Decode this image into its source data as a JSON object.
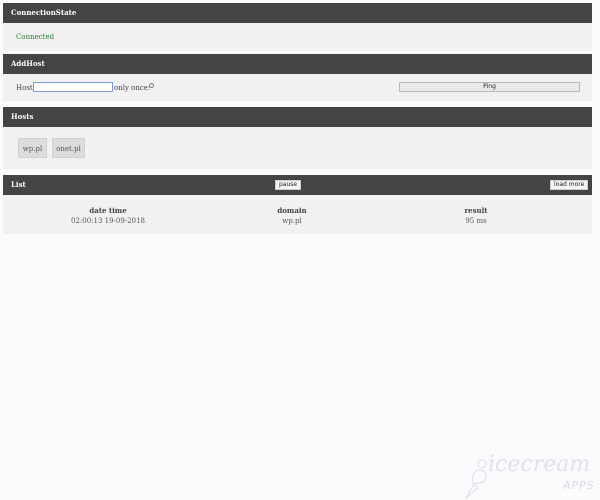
{
  "connection_state": {
    "title": "ConnectionState",
    "status": "Connected"
  },
  "add_host": {
    "title": "AddHost",
    "host_label": "Host:",
    "host_value": "",
    "only_once_label": "only once:",
    "only_once_checked": false,
    "ping_label": "Ping"
  },
  "hosts": {
    "title": "Hosts",
    "items": [
      "wp.pl",
      "onet.pl"
    ]
  },
  "list": {
    "title": "List",
    "pause_label": "pause",
    "load_more_label": "load more",
    "columns": [
      "date time",
      "domain",
      "result"
    ],
    "rows": [
      [
        "02:00:13 19-09-2018",
        "wp.pl",
        "95 ms"
      ]
    ]
  },
  "watermark": {
    "brand": "icecream",
    "sub": "APPS"
  },
  "colors": {
    "header_bg": "#444446",
    "panel_bg": "#f1f1f3",
    "status_ok": "#2a7a2a"
  }
}
